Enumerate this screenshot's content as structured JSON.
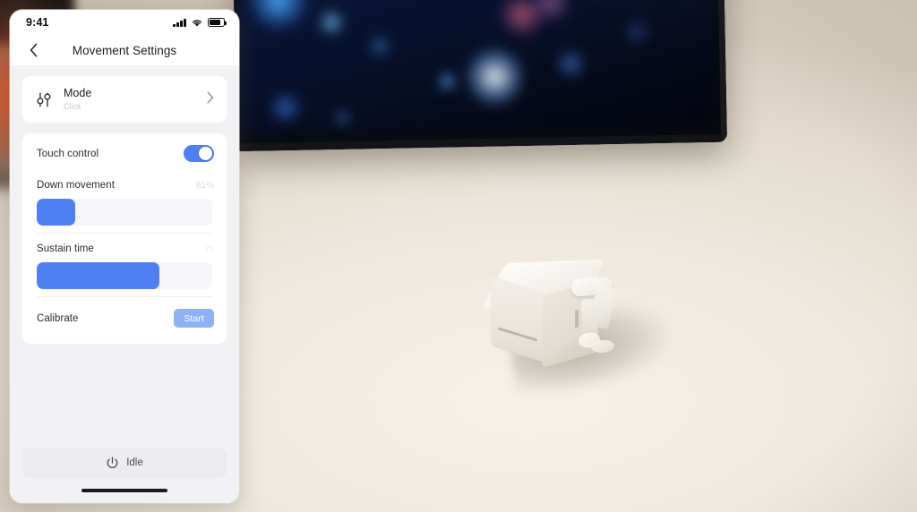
{
  "statusbar": {
    "time": "9:41",
    "signal_icon": "cellular-signal-icon",
    "wifi_icon": "wifi-icon",
    "battery_icon": "battery-icon"
  },
  "navbar": {
    "back_icon": "chevron-left-icon",
    "title": "Movement Settings"
  },
  "mode": {
    "icon": "sliders-adjust-icon",
    "title": "Mode",
    "subtitle": "Click",
    "chevron_icon": "chevron-right-icon"
  },
  "controls": {
    "touch_control": {
      "label": "Touch control",
      "toggle_state": "on"
    },
    "down_movement": {
      "label": "Down movement",
      "value": "61%",
      "percent": 22
    },
    "sustain_time": {
      "label": "Sustain time",
      "value": "7s",
      "percent": 70
    },
    "calibrate": {
      "label": "Calibrate",
      "button_label": "Start"
    }
  },
  "footer": {
    "power_icon": "power-icon",
    "status_label": "Idle",
    "home_indicator": "home-indicator"
  },
  "colors": {
    "accent_blue": "#4f7ff0",
    "button_blue": "#8fb1f5",
    "app_background": "#f2f2f4",
    "card_background": "#ffffff",
    "primary_text": "#1c1c1e",
    "secondary_text": "#8e8e93"
  }
}
